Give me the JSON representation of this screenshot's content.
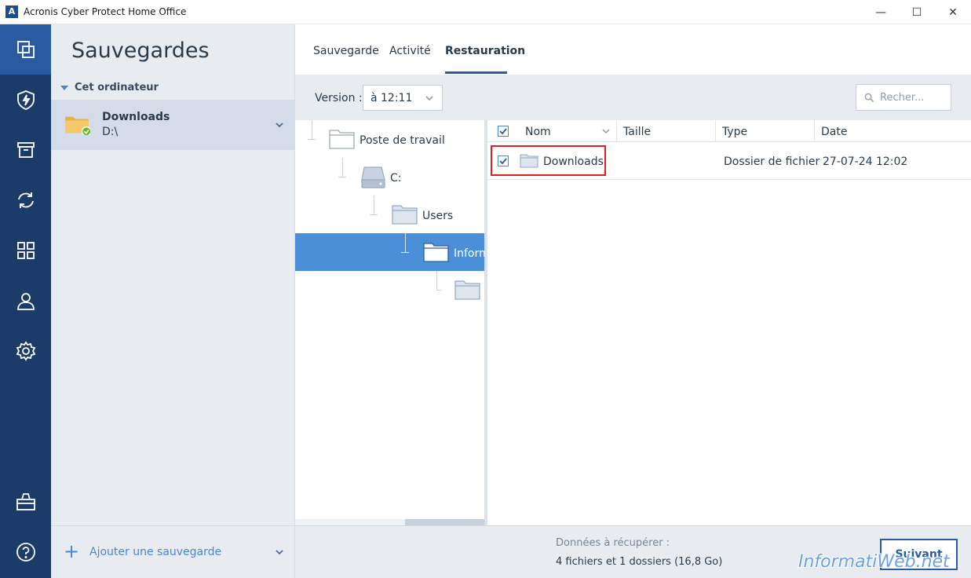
{
  "window": {
    "logo_letter": "A",
    "title": "Acronis Cyber Protect Home Office",
    "minimize": "—",
    "maximize": "☐",
    "close": "✕"
  },
  "rail": {
    "items": [
      {
        "name": "backups",
        "icon": "copy-icon"
      },
      {
        "name": "protection",
        "icon": "shield-bolt-icon"
      },
      {
        "name": "archive",
        "icon": "archive-box-icon"
      },
      {
        "name": "sync",
        "icon": "sync-arrows-icon"
      },
      {
        "name": "tools",
        "icon": "grid-icon"
      },
      {
        "name": "account",
        "icon": "user-icon"
      },
      {
        "name": "settings",
        "icon": "gear-icon"
      },
      {
        "name": "store",
        "icon": "shopping-bag-icon"
      },
      {
        "name": "help",
        "icon": "help-circle-icon"
      }
    ]
  },
  "backups_panel": {
    "title": "Sauvegardes",
    "group": "Cet ordinateur",
    "item": {
      "name": "Downloads",
      "path": "D:\\"
    },
    "add_label": "Ajouter une sauvegarde"
  },
  "tabs": [
    {
      "label": "Sauvegarde"
    },
    {
      "label": "Activité"
    },
    {
      "label": "Restauration"
    }
  ],
  "toolbar": {
    "version_label": "Version :",
    "version_value": "à 12:11",
    "search_placeholder": "Recher..."
  },
  "tree": {
    "nodes": [
      {
        "label": "Poste de travail"
      },
      {
        "label": "C:"
      },
      {
        "label": "Users"
      },
      {
        "label": "Inform"
      },
      {
        "label": ""
      }
    ]
  },
  "files": {
    "columns": [
      "Nom",
      "Taille",
      "Type",
      "Date"
    ],
    "rows": [
      {
        "name": "Downloads",
        "size": "",
        "type": "Dossier de fichier",
        "date": "27-07-24 12:02"
      }
    ]
  },
  "footer": {
    "label": "Données à récupérer :",
    "value": "4 fichiers et 1 dossiers (16,8 Go)",
    "next_label": "Suivant"
  },
  "watermark": "InformatiWeb.net",
  "colors": {
    "rail_bg": "#1b3c68",
    "rail_active": "#2a5ba0",
    "accent": "#4a87c9",
    "selection": "#4a8fd8",
    "highlight": "#e02020"
  }
}
